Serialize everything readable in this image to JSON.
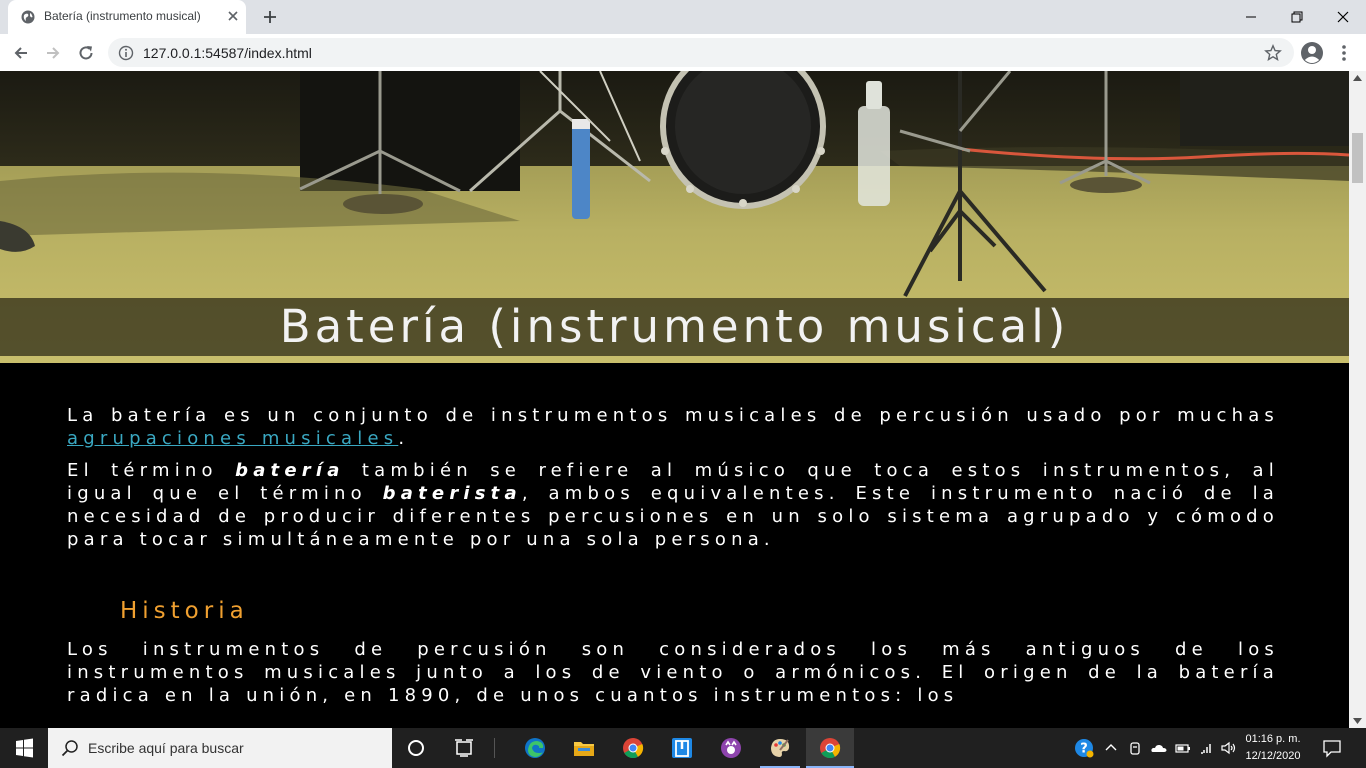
{
  "browser": {
    "tab_title": "Batería (instrumento musical)",
    "url": "127.0.0.1:54587/index.html"
  },
  "page": {
    "title": "Batería (instrumento musical)",
    "intro": {
      "p1_text": "La batería es un conjunto de instrumentos musicales de percusión usado por muchas",
      "p1_link": "agrupaciones musicales",
      "p1_end": ".",
      "p2_a": "El término",
      "p2_em1": "batería",
      "p2_b": "también se refiere al músico que toca estos instrumentos, al igual que el término",
      "p2_em2": "baterista",
      "p2_c": ", ambos equivalentes. Este instrumento nació de la necesidad de producir diferentes percusiones en un solo sistema agrupado y cómodo para tocar simultáneamente por una sola persona."
    },
    "historia": {
      "heading": "Historia",
      "p1": "Los instrumentos de percusión son considerados los más antiguos de los instrumentos musicales junto a los de viento o armónicos. El origen de la batería radica en la unión, en 1890, de unos cuantos instrumentos: los"
    },
    "colors": {
      "background": "#000000",
      "text": "#ffffff",
      "link": "#3aa8c2",
      "heading_accent": "#f0a030"
    }
  },
  "taskbar": {
    "search_placeholder": "Escribe aquí para buscar",
    "time": "01:16 p. m.",
    "date": "12/12/2020"
  }
}
